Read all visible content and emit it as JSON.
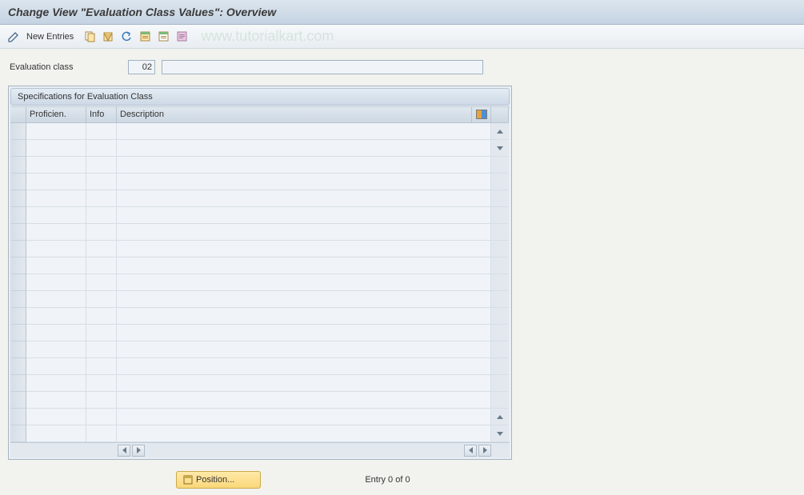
{
  "titlebar": {
    "title": "Change View \"Evaluation Class Values\": Overview"
  },
  "toolbar": {
    "new_entries_label": "New Entries",
    "watermark": "www.tutorialkart.com"
  },
  "fields": {
    "evaluation_class_label": "Evaluation class",
    "evaluation_class_value": "02",
    "evaluation_class_desc": ""
  },
  "panel": {
    "title": "Specifications for Evaluation Class",
    "columns": {
      "proficiency": "Proficien.",
      "info": "Info",
      "description": "Description"
    },
    "row_count": 19
  },
  "footer": {
    "position_label": "Position...",
    "entry_text": "Entry 0 of 0"
  }
}
